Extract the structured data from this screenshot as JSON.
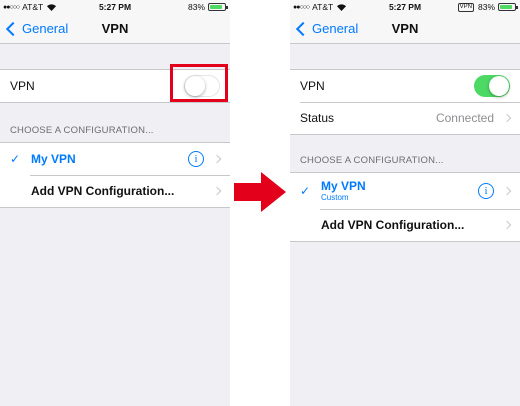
{
  "status_bar": {
    "carrier": "AT&T",
    "signal_dots": "●●○○○",
    "time": "5:27 PM",
    "battery": "83%",
    "battery_level": 0.83,
    "vpn_indicator": "VPN"
  },
  "nav": {
    "back_label": "General",
    "title": "VPN"
  },
  "left": {
    "vpn_label": "VPN",
    "vpn_toggle_on": false,
    "section_header": "CHOOSE A CONFIGURATION...",
    "config_name": "My VPN",
    "add_config_label": "Add VPN Configuration...",
    "highlight_color": "#e3001b"
  },
  "right": {
    "vpn_label": "VPN",
    "vpn_toggle_on": true,
    "status_label": "Status",
    "status_value": "Connected",
    "section_header": "CHOOSE A CONFIGURATION...",
    "config_name": "My VPN",
    "config_type": "Custom",
    "add_config_label": "Add VPN Configuration..."
  },
  "icons": {
    "check": "✓",
    "info": "i"
  },
  "colors": {
    "accent": "#007aff",
    "toggle_on": "#4cd964",
    "arrow": "#e3001b"
  }
}
